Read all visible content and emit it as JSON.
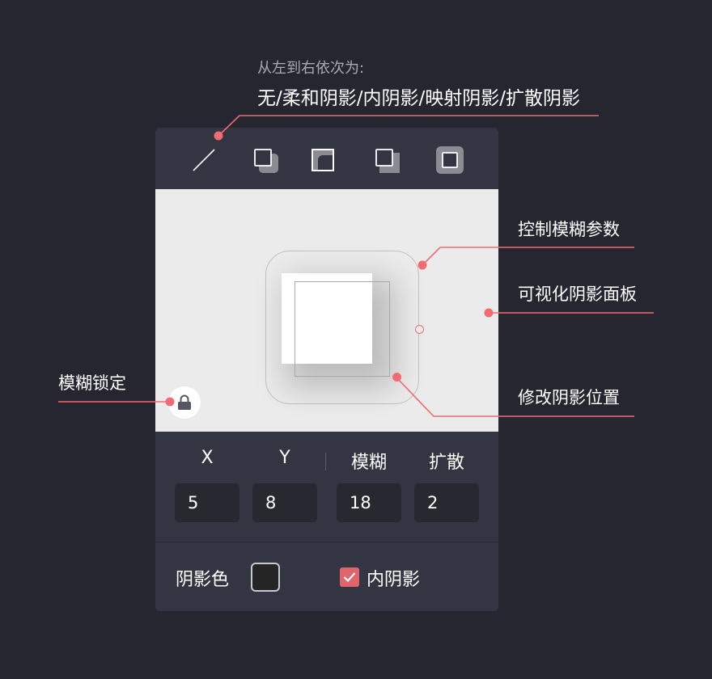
{
  "annotations": {
    "intro_sub": "从左到右依次为:",
    "intro_main": "无/柔和阴影/内阴影/映射阴影/扩散阴影",
    "blur_param": "控制模糊参数",
    "visual_panel": "可视化阴影面板",
    "blur_lock": "模糊锁定",
    "shadow_position": "修改阴影位置"
  },
  "toolbar": {
    "presets": [
      {
        "id": "none",
        "icon": "slash-icon"
      },
      {
        "id": "soft",
        "icon": "soft-shadow-icon"
      },
      {
        "id": "inner",
        "icon": "inner-shadow-icon"
      },
      {
        "id": "mapped",
        "icon": "mapped-shadow-icon"
      },
      {
        "id": "spread",
        "icon": "spread-shadow-icon",
        "selected": true
      }
    ]
  },
  "params": {
    "x_label": "X",
    "y_label": "Y",
    "blur_label": "模糊",
    "spread_label": "扩散",
    "x_value": "5",
    "y_value": "8",
    "blur_value": "18",
    "spread_value": "2"
  },
  "footer": {
    "color_label": "阴影色",
    "shadow_color": "#252525",
    "inner_shadow_label": "内阴影",
    "inner_shadow_checked": true
  },
  "colors": {
    "background": "#252630",
    "panel": "#333642",
    "accent": "#f06b72"
  }
}
